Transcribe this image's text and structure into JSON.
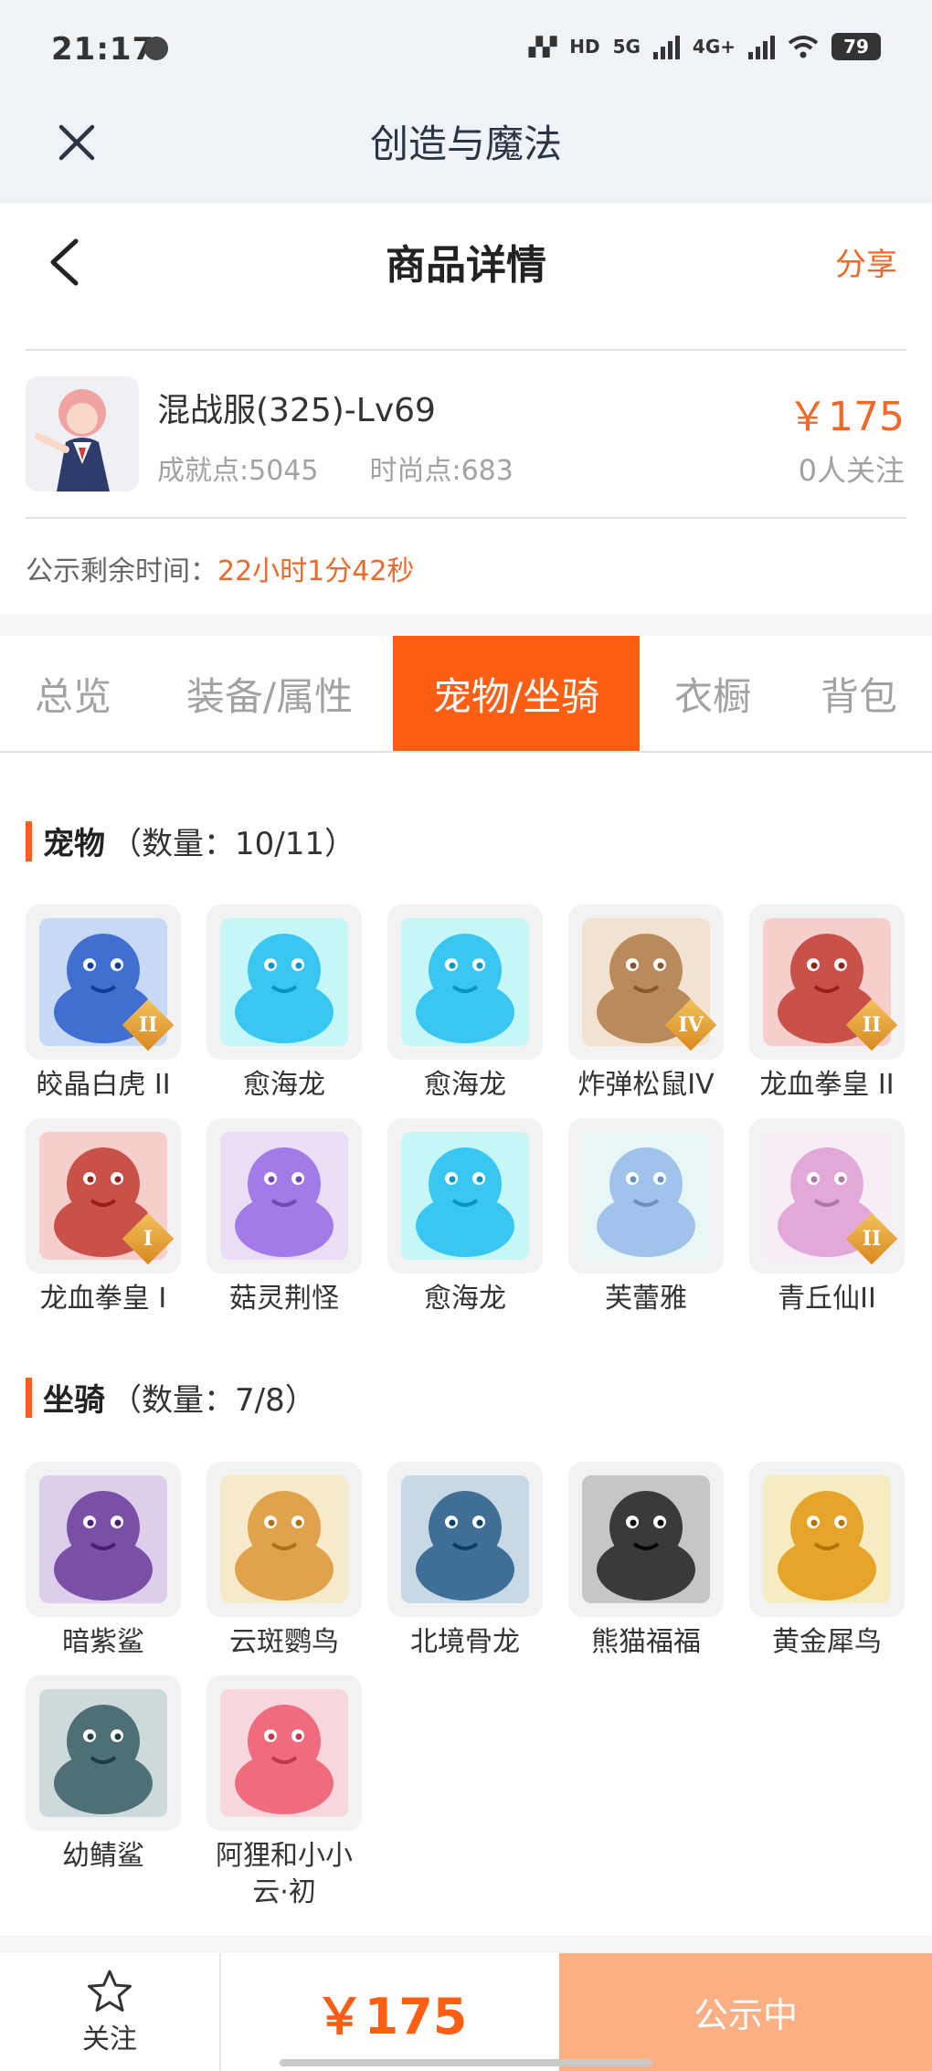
{
  "status_bar": {
    "time": "21:17",
    "network_a": "HD",
    "network_b": "5G",
    "network_c": "4G+",
    "battery": "79"
  },
  "app": {
    "title": "创造与魔法"
  },
  "header": {
    "title": "商品详情",
    "share_label": "分享"
  },
  "product": {
    "name": "混战服(325)-Lv69",
    "achievement": "成就点:5045",
    "fashion": "时尚点:683",
    "price": "￥175",
    "followers": "0人关注"
  },
  "notice": {
    "label": "公示剩余时间：",
    "time": "22小时1分42秒"
  },
  "tabs": [
    {
      "label": "总览",
      "active": false
    },
    {
      "label": "装备/属性",
      "active": false
    },
    {
      "label": "宠物/坐骑",
      "active": true
    },
    {
      "label": "衣橱",
      "active": false
    },
    {
      "label": "背包",
      "active": false
    }
  ],
  "pets": {
    "title": "宠物",
    "count": "（数量：10/11）",
    "items": [
      {
        "name": "皎晶白虎 II",
        "icon": "white-tiger-icon",
        "rank": "II",
        "color": "#3f6fd0"
      },
      {
        "name": "愈海龙",
        "icon": "sea-dragon-icon",
        "rank": "",
        "color": "#39c6f2"
      },
      {
        "name": "愈海龙",
        "icon": "sea-dragon-icon",
        "rank": "",
        "color": "#39c6f2"
      },
      {
        "name": "炸弹松鼠IV",
        "icon": "squirrel-icon",
        "rank": "IV",
        "color": "#b98a5c"
      },
      {
        "name": "龙血拳皇 II",
        "icon": "dragon-boxer-icon",
        "rank": "II",
        "color": "#c8514a"
      },
      {
        "name": "龙血拳皇 I",
        "icon": "dragon-boxer-icon",
        "rank": "I",
        "color": "#c8514a"
      },
      {
        "name": "菇灵荆怪",
        "icon": "mushroom-spirit-icon",
        "rank": "",
        "color": "#a27be8"
      },
      {
        "name": "愈海龙",
        "icon": "sea-dragon-icon",
        "rank": "",
        "color": "#39c6f2"
      },
      {
        "name": "芙蕾雅",
        "icon": "freya-icon",
        "rank": "",
        "color": "#9fc3ea"
      },
      {
        "name": "青丘仙II",
        "icon": "fox-fairy-icon",
        "rank": "II",
        "color": "#e2a9d8"
      }
    ]
  },
  "mounts": {
    "title": "坐骑",
    "count": "（数量：7/8）",
    "items": [
      {
        "name": "暗紫鲨",
        "icon": "purple-shark-icon",
        "color": "#7a4fa6"
      },
      {
        "name": "云斑鹦鸟",
        "icon": "parrot-icon",
        "color": "#e0a24a"
      },
      {
        "name": "北境骨龙",
        "icon": "bone-dragon-icon",
        "color": "#3f6f96"
      },
      {
        "name": "熊猫福福",
        "icon": "panda-icon",
        "color": "#3a3a3a"
      },
      {
        "name": "黄金犀鸟",
        "icon": "hornbill-icon",
        "color": "#e6a52a"
      },
      {
        "name": "幼鲭鲨",
        "icon": "shark-icon",
        "color": "#4e6f74"
      },
      {
        "name": "阿狸和小小云·初",
        "icon": "ali-fox-icon",
        "color": "#ef6b7d"
      }
    ]
  },
  "bottom": {
    "follow_label": "关注",
    "price": "￥175",
    "status_label": "公示中"
  },
  "colors": {
    "accent": "#fc5f13",
    "price": "#f0682a",
    "status_button": "#fbaf82"
  }
}
